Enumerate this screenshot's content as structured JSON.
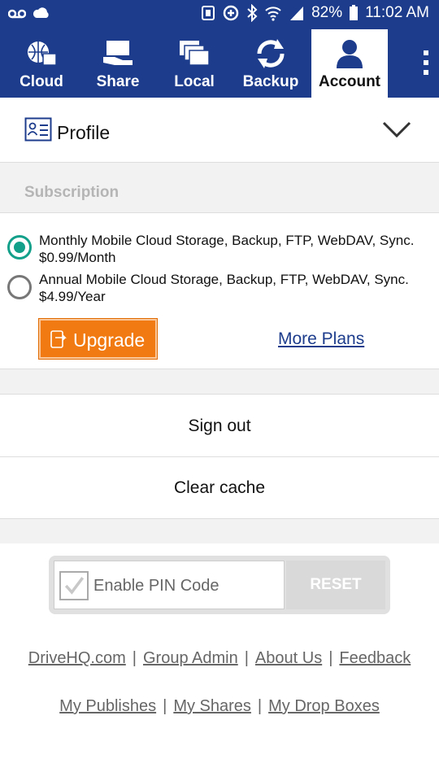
{
  "status_bar": {
    "battery": "82%",
    "time": "11:02 AM",
    "left_icons": [
      "voicemail-icon",
      "cloud-sync-icon"
    ],
    "right_icons": [
      "nfc-icon",
      "data-saver-icon",
      "bluetooth-icon",
      "wifi-icon",
      "signal-icon",
      "battery-icon"
    ]
  },
  "nav": {
    "tabs": [
      {
        "label": "Cloud",
        "icon": "cloud-globe-icon"
      },
      {
        "label": "Share",
        "icon": "share-hand-icon"
      },
      {
        "label": "Local",
        "icon": "local-windows-icon"
      },
      {
        "label": "Backup",
        "icon": "backup-sync-icon"
      },
      {
        "label": "Account",
        "icon": "account-person-icon"
      }
    ],
    "active": "Account"
  },
  "profile": {
    "label": "Profile"
  },
  "subscription": {
    "header": "Subscription",
    "plans": [
      {
        "line1": "Monthly Mobile Cloud Storage, Backup, FTP, WebDAV, Sync.",
        "line2": "$0.99/Month",
        "selected": true
      },
      {
        "line1": "Annual Mobile Cloud Storage, Backup, FTP, WebDAV, Sync.",
        "line2": "$4.99/Year",
        "selected": false
      }
    ],
    "upgrade_label": "Upgrade",
    "more_plans_label": "More Plans"
  },
  "actions": {
    "sign_out": "Sign out",
    "clear_cache": "Clear cache"
  },
  "pin": {
    "label": "Enable PIN Code",
    "reset_label": "RESET"
  },
  "footer": {
    "row1": [
      "DriveHQ.com",
      "Group Admin",
      "About Us",
      "Feedback"
    ],
    "row2": [
      "My Publishes",
      "My Shares",
      "My Drop Boxes"
    ],
    "separator": "|"
  },
  "colors": {
    "brand_blue": "#1d3d8c",
    "accent_orange": "#f17a12",
    "radio_green": "#13a08a",
    "reset_gray": "#d9d9d9"
  }
}
